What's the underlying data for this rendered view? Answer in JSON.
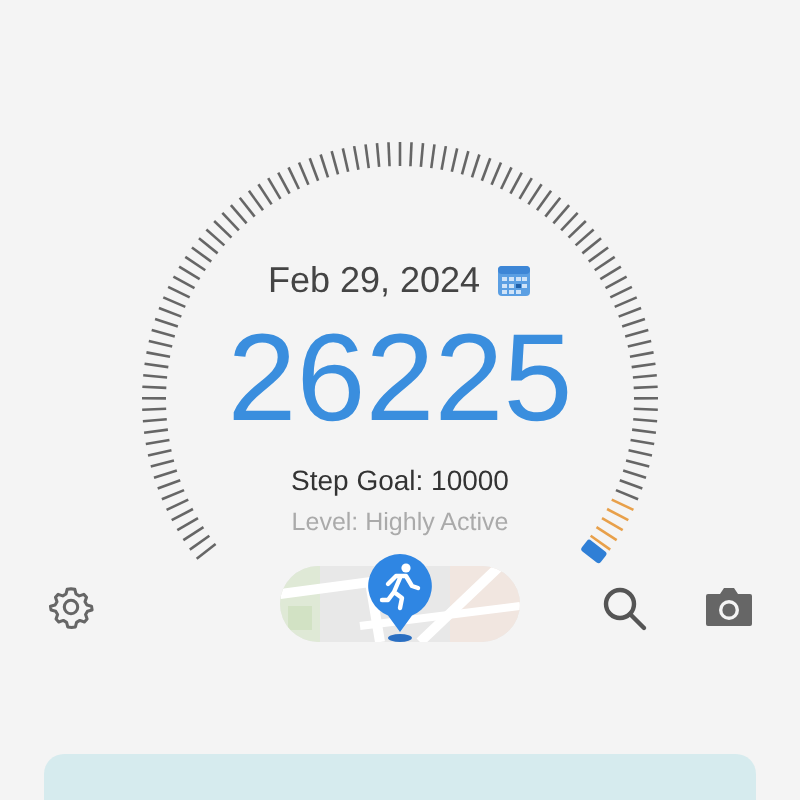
{
  "date": "Feb 29, 2024",
  "steps": "26225",
  "step_goal": "Step Goal: 10000",
  "activity_level": "Level: Highly Active"
}
